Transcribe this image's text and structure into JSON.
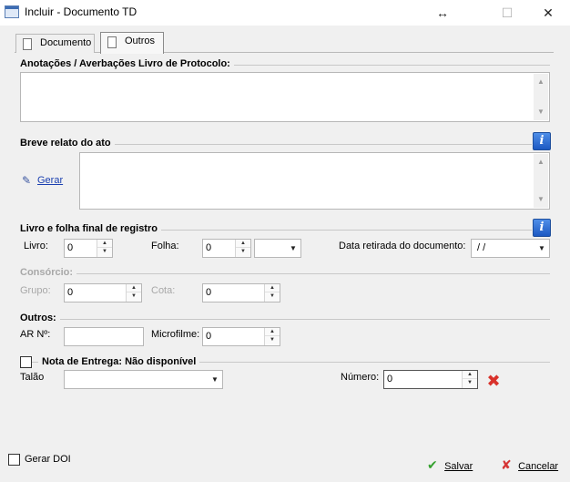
{
  "window": {
    "title": "Incluir - Documento TD",
    "resize_glyph": "↔",
    "maximize_glyph": "☐",
    "close_glyph": "✕"
  },
  "tabs": [
    {
      "label": "Documento",
      "active": false
    },
    {
      "label": "Outros",
      "active": true
    }
  ],
  "anotacoes": {
    "title": "Anotações / Averbações Livro de Protocolo:",
    "value": ""
  },
  "breve_relato": {
    "title": "Breve relato do ato",
    "gerar_label": "Gerar",
    "value": "",
    "info_glyph": "i"
  },
  "livro_folha": {
    "title": "Livro e folha final de registro",
    "info_glyph": "i",
    "livro_label": "Livro:",
    "livro_value": "0",
    "folha_label": "Folha:",
    "folha_value": "0",
    "folha_suffix_value": "",
    "data_retirada_label": "Data retirada do documento:",
    "data_retirada_value": " / /"
  },
  "consorcio": {
    "title": "Consórcio:",
    "grupo_label": "Grupo:",
    "grupo_value": "0",
    "cota_label": "Cota:",
    "cota_value": "0"
  },
  "outros": {
    "title": "Outros:",
    "ar_label": "AR Nº:",
    "ar_value": "",
    "microfilme_label": "Microfilme:",
    "microfilme_value": "0"
  },
  "nota_entrega": {
    "title": "Nota de Entrega: Não disponível",
    "checked": false,
    "talao_label": "Talão",
    "talao_value": "",
    "numero_label": "Número:",
    "numero_value": "0"
  },
  "footer": {
    "gerar_doi_label": "Gerar DOI",
    "gerar_doi_checked": false,
    "salvar_label": "Salvar",
    "cancelar_label": "Cancelar"
  },
  "colors": {
    "info_blue": "#1c58c2",
    "link_blue": "#1a3fb0",
    "save_green": "#35a12f",
    "cancel_red": "#d63535",
    "disabled_gray": "#a8a8a8"
  }
}
